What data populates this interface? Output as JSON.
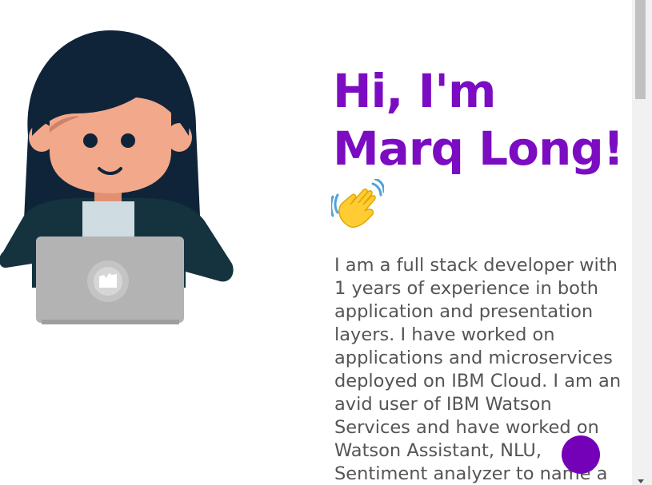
{
  "hero": {
    "greeting_line1": "Hi, I'm",
    "greeting_line2": "Marq Long!",
    "wave_emoji_icon": "waving-hand-icon",
    "bio": "I am a full stack developer with 1 years of experience in both application and presentation layers. I have worked on applications and microservices deployed on IBM Cloud. I am an avid user of IBM Watson Services and have worked on Watson Assistant, NLU, Sentiment analyzer to name a few."
  },
  "illustration": {
    "icon": "developer-with-laptop-illustration"
  },
  "colors": {
    "accent": "#7b0cc2",
    "fab": "#7400b8",
    "body_text": "#555555",
    "hair": "#0f2439",
    "skin": "#f2a88a",
    "jacket": "#14333f",
    "laptop": "#b3b3b3"
  },
  "fab": {
    "icon": "circle-action-button"
  }
}
